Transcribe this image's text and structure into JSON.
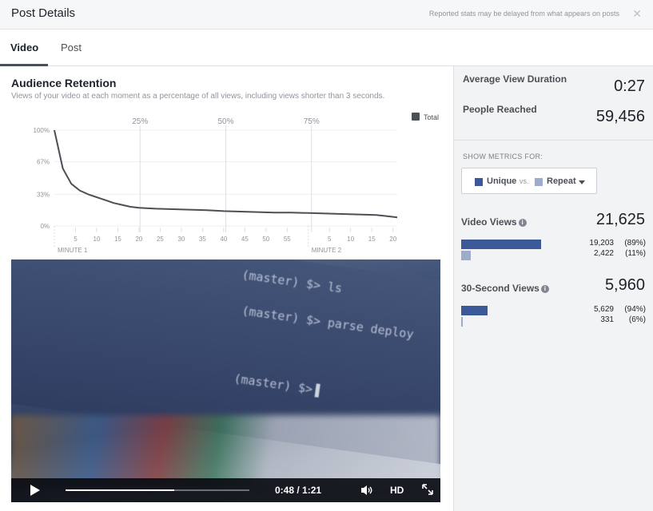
{
  "header": {
    "title": "Post Details",
    "note": "Reported stats may be delayed from what appears on posts",
    "close_glyph": "✕"
  },
  "tabs": [
    {
      "label": "Video",
      "active": true
    },
    {
      "label": "Post",
      "active": false
    }
  ],
  "retention": {
    "title": "Audience Retention",
    "subtitle": "Views of your video at each moment as a percentage of all views, including views shorter than 3 seconds."
  },
  "chart_data": {
    "type": "line",
    "title": "",
    "legend": [
      {
        "name": "Total",
        "color": "#4b4f56"
      }
    ],
    "legend_position": "top-right",
    "y_ticks": [
      "100%",
      "67%",
      "33%",
      "0%"
    ],
    "ylim": [
      0,
      100
    ],
    "y_ticks_values": [
      100,
      67,
      33,
      0
    ],
    "x_ticks": [
      "5",
      "10",
      "15",
      "20",
      "25",
      "30",
      "35",
      "40",
      "45",
      "50",
      "55",
      "5",
      "10",
      "15",
      "20"
    ],
    "x_ticks_seconds": [
      5,
      10,
      15,
      20,
      25,
      30,
      35,
      40,
      45,
      50,
      55,
      65,
      70,
      75,
      80
    ],
    "minute_labels": [
      {
        "label": "MINUTE 1",
        "second": 0
      },
      {
        "label": "MINUTE 2",
        "second": 60
      }
    ],
    "quartile_labels": [
      {
        "label": "25%",
        "second": 20.25
      },
      {
        "label": "50%",
        "second": 40.5
      },
      {
        "label": "75%",
        "second": 60.75
      }
    ],
    "xlim": [
      0,
      81
    ],
    "series": [
      {
        "name": "Total",
        "x": [
          0,
          2,
          4,
          6,
          8,
          10,
          12,
          14,
          16,
          18,
          20,
          24,
          28,
          32,
          36,
          40,
          44,
          48,
          52,
          56,
          60,
          64,
          68,
          72,
          76,
          78,
          80,
          81
        ],
        "y": [
          100,
          60,
          44,
          37,
          33,
          30,
          27,
          24,
          22,
          20,
          19,
          18,
          17.5,
          17,
          16.5,
          15.5,
          15,
          14.5,
          14,
          14,
          13.5,
          13,
          12.5,
          12,
          11.5,
          10.5,
          9.5,
          9
        ]
      }
    ],
    "grid": true
  },
  "video": {
    "terminal_lines": [
      "(master) $> ls",
      "(master) $> parse deploy",
      "(master) $>"
    ],
    "time": "0:48 / 1:21",
    "progress": 0.59,
    "hd_label": "HD",
    "play_glyph": "▶",
    "volume_glyph": "🔊",
    "fullscreen_glyph": "⤢"
  },
  "metrics": {
    "avg_duration_label": "Average View Duration",
    "avg_duration_value": "0:27",
    "reached_label": "People Reached",
    "reached_value": "59,456",
    "show_for_label": "SHOW METRICS FOR:",
    "toggle_unique": "Unique",
    "toggle_vs": "vs.",
    "toggle_repeat": "Repeat",
    "colors": {
      "unique": "#3b5998",
      "repeat": "#9daccb"
    }
  },
  "video_views": {
    "label": "Video Views",
    "value": "21,625",
    "unique_num": "19,203",
    "unique_pct": "(89%)",
    "unique_frac": 0.89,
    "repeat_num": "2,422",
    "repeat_pct": "(11%)",
    "repeat_frac": 0.11
  },
  "thirty_sec_views": {
    "label": "30-Second Views",
    "value": "5,960",
    "unique_num": "5,629",
    "unique_pct": "(94%)",
    "unique_frac": 0.94,
    "repeat_num": "331",
    "repeat_pct": "(6%)",
    "repeat_frac": 0.06
  },
  "info_glyph": "i"
}
